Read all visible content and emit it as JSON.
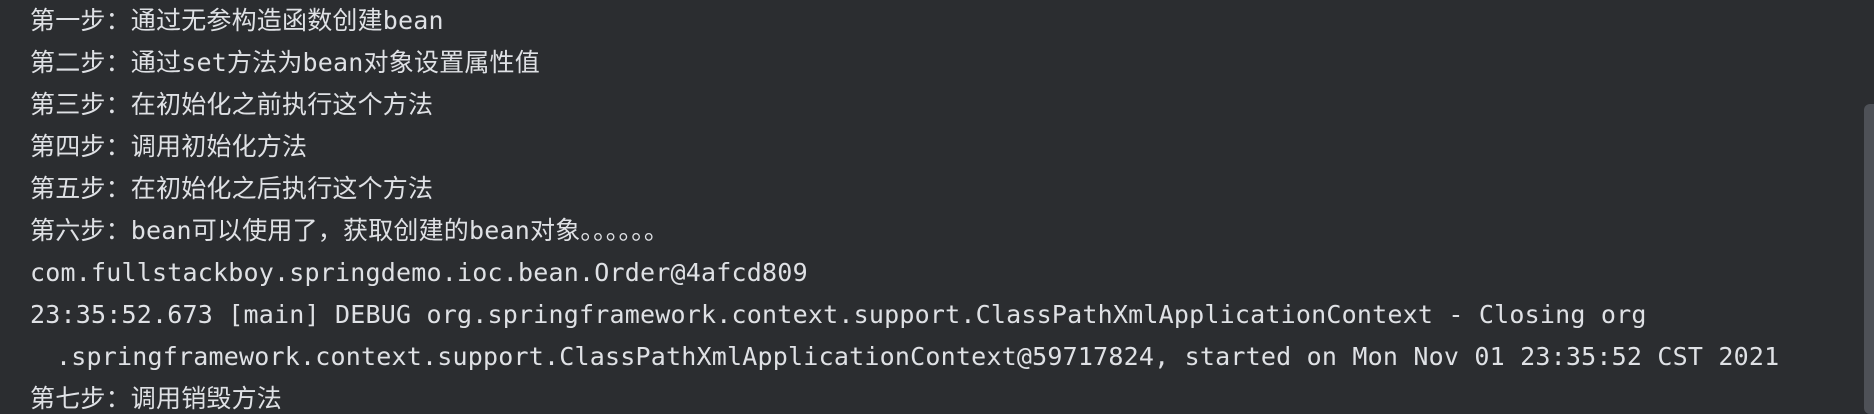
{
  "console": {
    "lines": [
      "第一步：通过无参构造函数创建bean",
      "第二步：通过set方法为bean对象设置属性值",
      "第三步：在初始化之前执行这个方法",
      "第四步：调用初始化方法",
      "第五步：在初始化之后执行这个方法",
      "第六步：bean可以使用了，获取创建的bean对象。。。。。。",
      "com.fullstackboy.springdemo.ioc.bean.Order@4afcd809",
      "23:35:52.673 [main] DEBUG org.springframework.context.support.ClassPathXmlApplicationContext - Closing org",
      ".springframework.context.support.ClassPathXmlApplicationContext@59717824, started on Mon Nov 01 23:35:52 CST 2021",
      "第七步：调用销毁方法"
    ]
  }
}
